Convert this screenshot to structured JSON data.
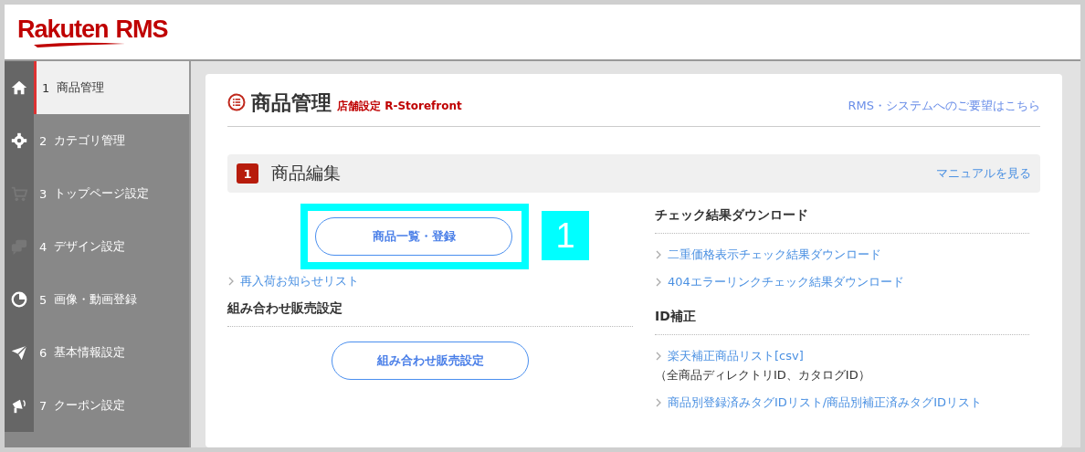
{
  "logo": {
    "brand": "Rakuten",
    "product": "RMS"
  },
  "sidebar": {
    "items": [
      {
        "number": "1",
        "label": "商品管理",
        "selected": true
      },
      {
        "number": "2",
        "label": "カテゴリ管理",
        "selected": false
      },
      {
        "number": "3",
        "label": "トップページ設定",
        "selected": false
      },
      {
        "number": "4",
        "label": "デザイン設定",
        "selected": false
      },
      {
        "number": "5",
        "label": "画像・動画登録",
        "selected": false
      },
      {
        "number": "6",
        "label": "基本情報設定",
        "selected": false
      },
      {
        "number": "7",
        "label": "クーポン設定",
        "selected": false
      }
    ]
  },
  "page": {
    "title": "商品管理",
    "subtitle": "店舗設定 R-Storefront",
    "feedback_link": "RMS・システムへのご要望はこちら"
  },
  "section": {
    "number": "1",
    "title": "商品編集",
    "manual_link": "マニュアルを見る"
  },
  "left": {
    "primary_button": "商品一覧・登録",
    "restock_link": "再入荷お知らせリスト",
    "bundle_heading": "組み合わせ販売設定",
    "bundle_button": "組み合わせ販売設定"
  },
  "annotation": {
    "label": "1"
  },
  "right": {
    "groups": [
      {
        "heading": "チェック結果ダウンロード",
        "links": [
          {
            "text": "二重価格表示チェック結果ダウンロード"
          },
          {
            "text": "404エラーリンクチェック結果ダウンロード"
          }
        ]
      },
      {
        "heading": "ID補正",
        "links": [
          {
            "text": "楽天補正商品リスト[csv]",
            "note": "（全商品ディレクトリID、カタログID）"
          },
          {
            "text": "商品別登録済みタグIDリスト/商品別補正済みタグIDリスト"
          }
        ]
      }
    ]
  }
}
